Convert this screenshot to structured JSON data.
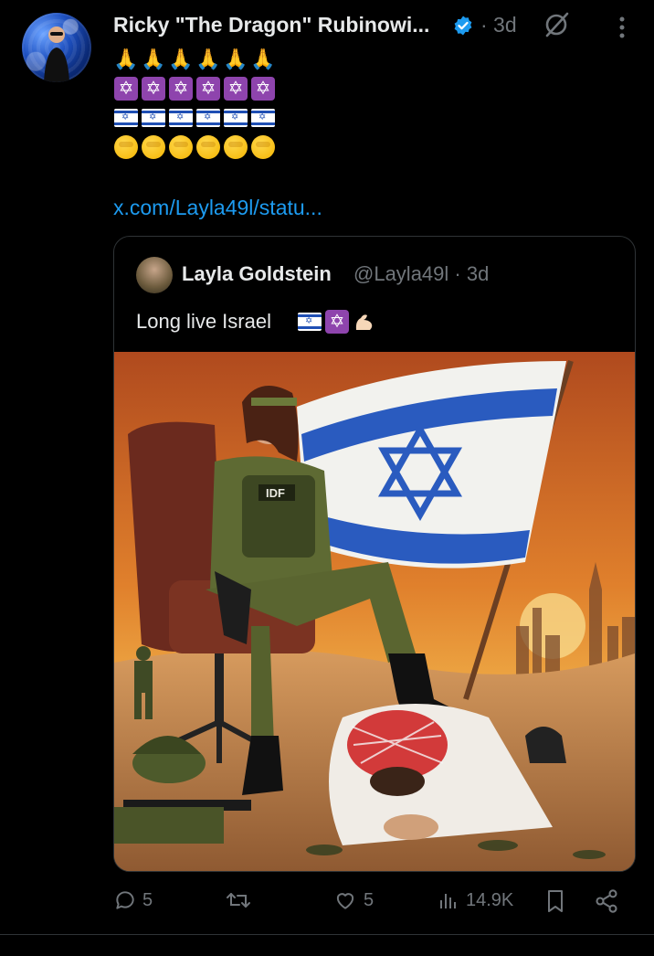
{
  "post": {
    "author_name": "Ricky \"The Dragon\" Rubinowi...",
    "time": "· 3d",
    "emoji_rows": [
      {
        "kind": "pray",
        "count": 6
      },
      {
        "kind": "star",
        "count": 6
      },
      {
        "kind": "flag",
        "count": 6
      },
      {
        "kind": "salute",
        "count": 6
      }
    ],
    "link": "x.com/Layla49l/statu..."
  },
  "quoted": {
    "name": "Layla Goldstein",
    "handle": "@Layla49l · 3d",
    "text": "Long live Israel",
    "image_alt_elements": {
      "patch_text": "IDF"
    }
  },
  "actions": {
    "reply_count": "5",
    "like_count": "5",
    "views_count": "14.9K"
  },
  "colors": {
    "background": "#000000",
    "text": "#e7e9ea",
    "muted": "#71767b",
    "link": "#1d9bf0",
    "border": "#2f3336"
  }
}
